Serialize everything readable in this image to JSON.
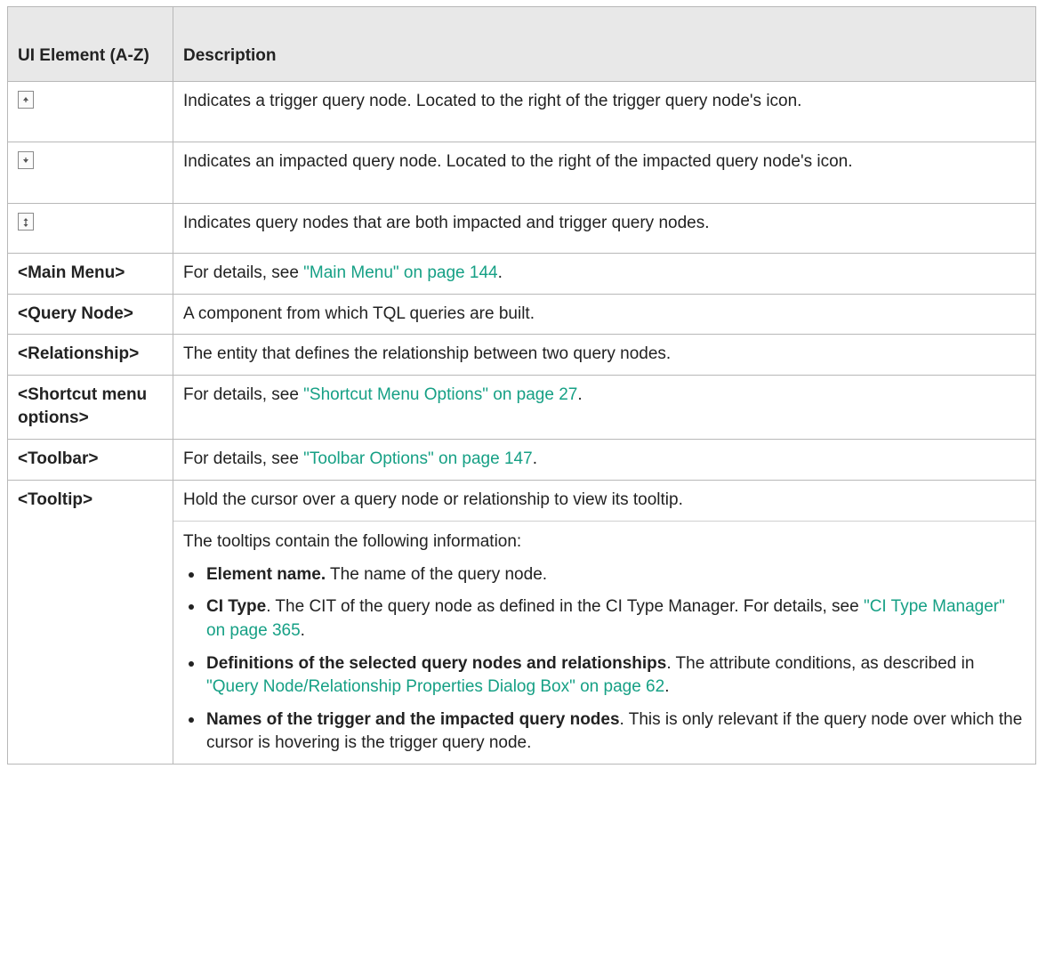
{
  "table": {
    "header": {
      "col1": "UI Element (A-Z)",
      "col2": "Description"
    },
    "rows": [
      {
        "icon": "trigger-query-node-icon",
        "description": "Indicates a trigger query node. Located to the right of the trigger query node's icon."
      },
      {
        "icon": "impacted-query-node-icon",
        "description": "Indicates an impacted query node. Located to the right of the impacted query node's icon."
      },
      {
        "icon": "trigger-and-impacted-query-node-icon",
        "description": "Indicates query nodes that are both impacted and trigger query nodes."
      },
      {
        "element": "<Main Menu>",
        "desc_prefix": "For details, see ",
        "link": "\"Main Menu\" on page 144",
        "desc_suffix": "."
      },
      {
        "element": "<Query Node>",
        "description": "A component from which TQL queries are built."
      },
      {
        "element": "<Relationship>",
        "description": "The entity that defines the relationship between two query nodes."
      },
      {
        "element": "<Shortcut menu options>",
        "desc_prefix": "For details, see ",
        "link": "\"Shortcut Menu Options\" on page 27",
        "desc_suffix": "."
      },
      {
        "element": "<Toolbar>",
        "desc_prefix": "For details, see ",
        "link": "\"Toolbar Options\" on page 147",
        "desc_suffix": "."
      },
      {
        "element": "<Tooltip>",
        "para1": "Hold the cursor over a query node or relationship to view its tooltip.",
        "para2": "The tooltips contain the following information:",
        "bullets": [
          {
            "bold": "Element name.",
            "text": " The name of the query node."
          },
          {
            "bold": "CI Type",
            "text": ". The CIT of the query node as defined in the CI Type Manager. For details, see ",
            "link": "\"CI Type Manager\" on page 365",
            "suffix": "."
          },
          {
            "bold": "Definitions of the selected query nodes and relationships",
            "text": ". The attribute conditions, as described in ",
            "link": "\"Query Node/Relationship Properties Dialog Box\" on page 62",
            "suffix": "."
          },
          {
            "bold": "Names of the trigger and the impacted query nodes",
            "text": ". This is only relevant if the query node over which the cursor is hovering is the trigger query node."
          }
        ]
      }
    ]
  },
  "colors": {
    "link": "#16a085",
    "header_bg": "#e8e8e8",
    "border": "#b8b8b8"
  }
}
